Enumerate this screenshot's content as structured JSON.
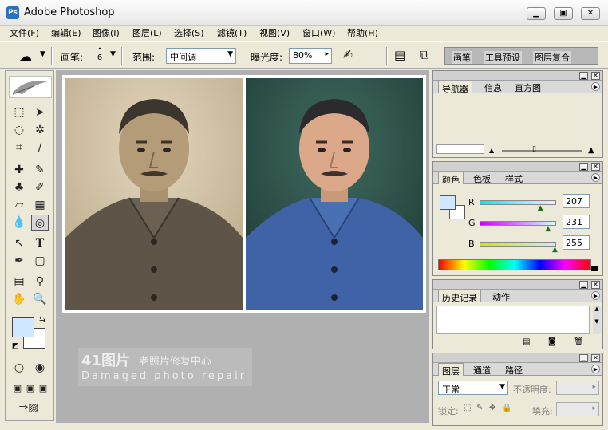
{
  "window": {
    "title": "Adobe Photoshop",
    "icon_label": "Ps",
    "controls": [
      "minimize-icon",
      "restore-icon",
      "close-icon"
    ]
  },
  "menu": [
    "文件(F)",
    "编辑(E)",
    "图像(I)",
    "图层(L)",
    "选择(S)",
    "滤镜(T)",
    "视图(V)",
    "窗口(W)",
    "帮助(H)"
  ],
  "options": {
    "brush_label": "画笔:",
    "brush_size": "6",
    "range_label": "范围:",
    "range_value": "中间调",
    "exposure_label": "曝光度:",
    "exposure_value": "80%",
    "well_tabs": [
      "画笔",
      "工具预设",
      "图层复合"
    ]
  },
  "navigator": {
    "tabs": [
      "导航器",
      "信息",
      "直方图"
    ]
  },
  "color": {
    "tabs": [
      "颜色",
      "色板",
      "样式"
    ],
    "channels": [
      {
        "label": "R",
        "value": "207",
        "level": 0.81
      },
      {
        "label": "G",
        "value": "231",
        "level": 0.91
      },
      {
        "label": "B",
        "value": "255",
        "level": 1.0
      }
    ],
    "foreground": "#cfe7ff",
    "background": "#ffffff"
  },
  "history": {
    "tabs": [
      "历史记录",
      "动作"
    ]
  },
  "layers": {
    "tabs": [
      "图层",
      "通道",
      "路径"
    ],
    "blend_mode": "正常",
    "opacity_label": "不透明度:",
    "lock_label": "锁定:",
    "fill_label": "填充:"
  },
  "watermark": {
    "brand": "41图片",
    "brand_sub": "老照片修复中心",
    "caption": "Damaged photo repair"
  }
}
